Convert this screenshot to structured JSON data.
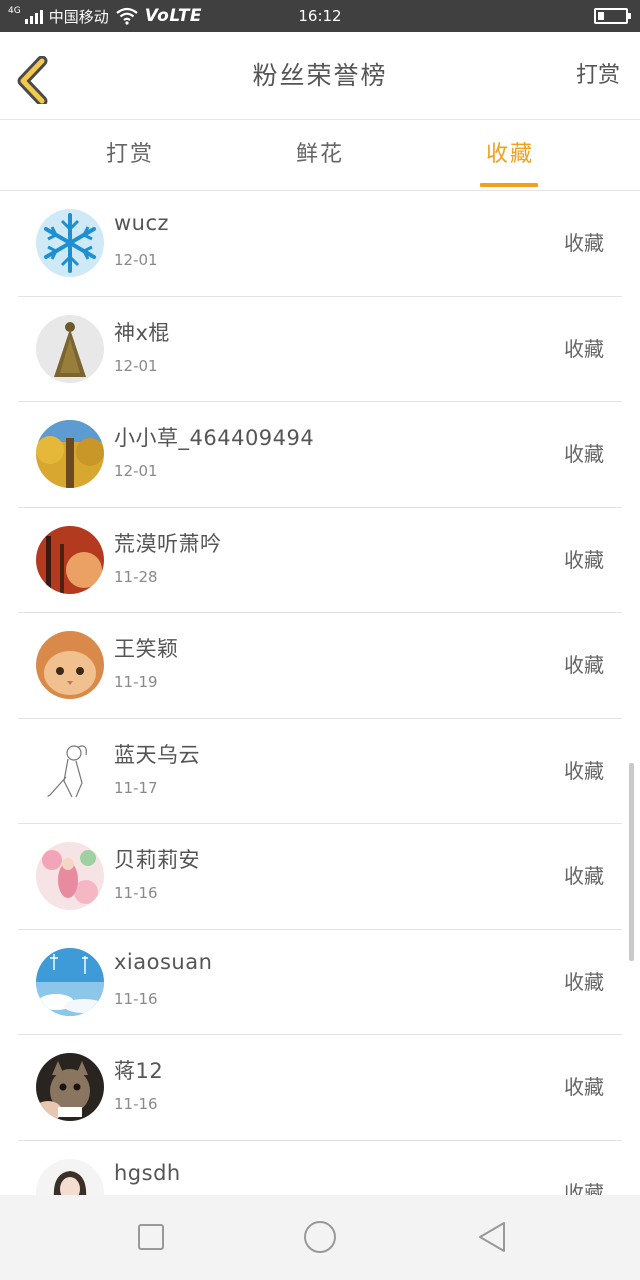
{
  "status_bar": {
    "network_badge": "4G",
    "carrier": "中国移动",
    "volte": "VoLTE",
    "time": "16:12"
  },
  "header": {
    "back_icon": "chevron-left-icon",
    "title": "粉丝荣誉榜",
    "action_label": "打赏"
  },
  "tabs": [
    {
      "label": "打赏",
      "active": false
    },
    {
      "label": "鲜花",
      "active": false
    },
    {
      "label": "收藏",
      "active": true
    }
  ],
  "accent_color": "#f0a01c",
  "rows": [
    {
      "name": "wucz",
      "date": "12-01",
      "action": "收藏"
    },
    {
      "name": "神x棍",
      "date": "12-01",
      "action": "收藏"
    },
    {
      "name": "小小草_464409494",
      "date": "12-01",
      "action": "收藏"
    },
    {
      "name": "荒漠听萧吟",
      "date": "11-28",
      "action": "收藏"
    },
    {
      "name": "王笑颖",
      "date": "11-19",
      "action": "收藏"
    },
    {
      "name": "蓝天乌云",
      "date": "11-17",
      "action": "收藏"
    },
    {
      "name": "贝莉莉安",
      "date": "11-16",
      "action": "收藏"
    },
    {
      "name": "xiaosuan",
      "date": "11-16",
      "action": "收藏"
    },
    {
      "name": "蒋12",
      "date": "11-16",
      "action": "收藏"
    },
    {
      "name": "hgsdh",
      "date": "",
      "action": "收藏"
    }
  ],
  "navbar": {
    "recent_icon": "square-icon",
    "home_icon": "circle-icon",
    "back_icon": "triangle-back-icon"
  }
}
